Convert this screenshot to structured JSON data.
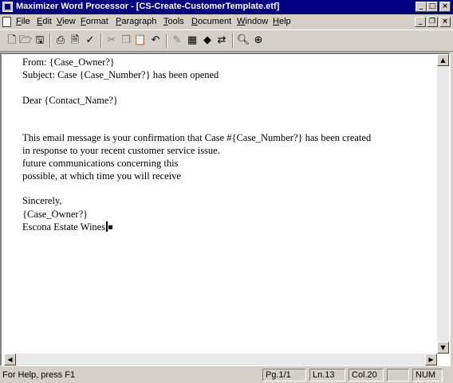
{
  "window": {
    "title": "Maximizer Word Processor - [CS-Create-CustomerTemplate.etf]",
    "title_color": "#000080"
  },
  "menu": [
    "File",
    "Edit",
    "View",
    "Format",
    "Paragraph",
    "Tools",
    "Document",
    "Window",
    "Help"
  ],
  "toolbar": {
    "icons": [
      "new-document-icon",
      "open-folder-icon",
      "save-icon",
      "print-icon",
      "print-preview-icon",
      "spell-check-icon",
      "cut-icon",
      "copy-icon",
      "paste-icon",
      "undo-icon",
      "insert-field-icon",
      "insert-table-icon",
      "insert-object-icon",
      "find-replace-icon",
      "find-icon",
      "zoom-icon"
    ]
  },
  "document": {
    "lines": [
      "From: {Case_Owner?}",
      "Subject: Case {Case_Number?} has been opened",
      "",
      "Dear {Contact_Name?}",
      "",
      "This email message is your confirmation that Case #{Case_Number?} has been created",
      "in response to your recent customer service issue.",
      "future communications concerning this",
      "possible, at which time you will receive",
      "",
      "Sincerely,",
      "{Case_Owner?}",
      "Escona Estate Wines"
    ]
  },
  "status": {
    "help": "For Help, press F1",
    "page": "Pg.1/1",
    "line": "Ln.13",
    "col": "Col.20",
    "num": "NUM"
  }
}
